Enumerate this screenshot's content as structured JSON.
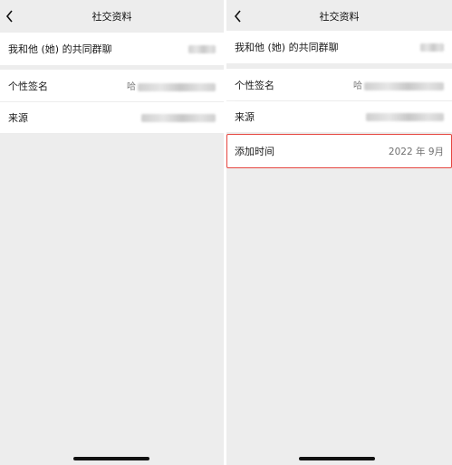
{
  "screens": [
    {
      "title": "社交资料",
      "rows": [
        {
          "label": "我和他 (她) 的共同群聊"
        },
        {
          "label": "个性签名",
          "value_prefix": "哈"
        },
        {
          "label": "来源"
        }
      ]
    },
    {
      "title": "社交资料",
      "rows": [
        {
          "label": "我和他 (她) 的共同群聊"
        },
        {
          "label": "个性签名",
          "value_prefix": "哈"
        },
        {
          "label": "来源"
        }
      ],
      "added_time": {
        "label": "添加时间",
        "value": "2022 年 9月"
      }
    }
  ],
  "colors": {
    "highlight_border": "#e5453f",
    "background": "#ededed"
  }
}
